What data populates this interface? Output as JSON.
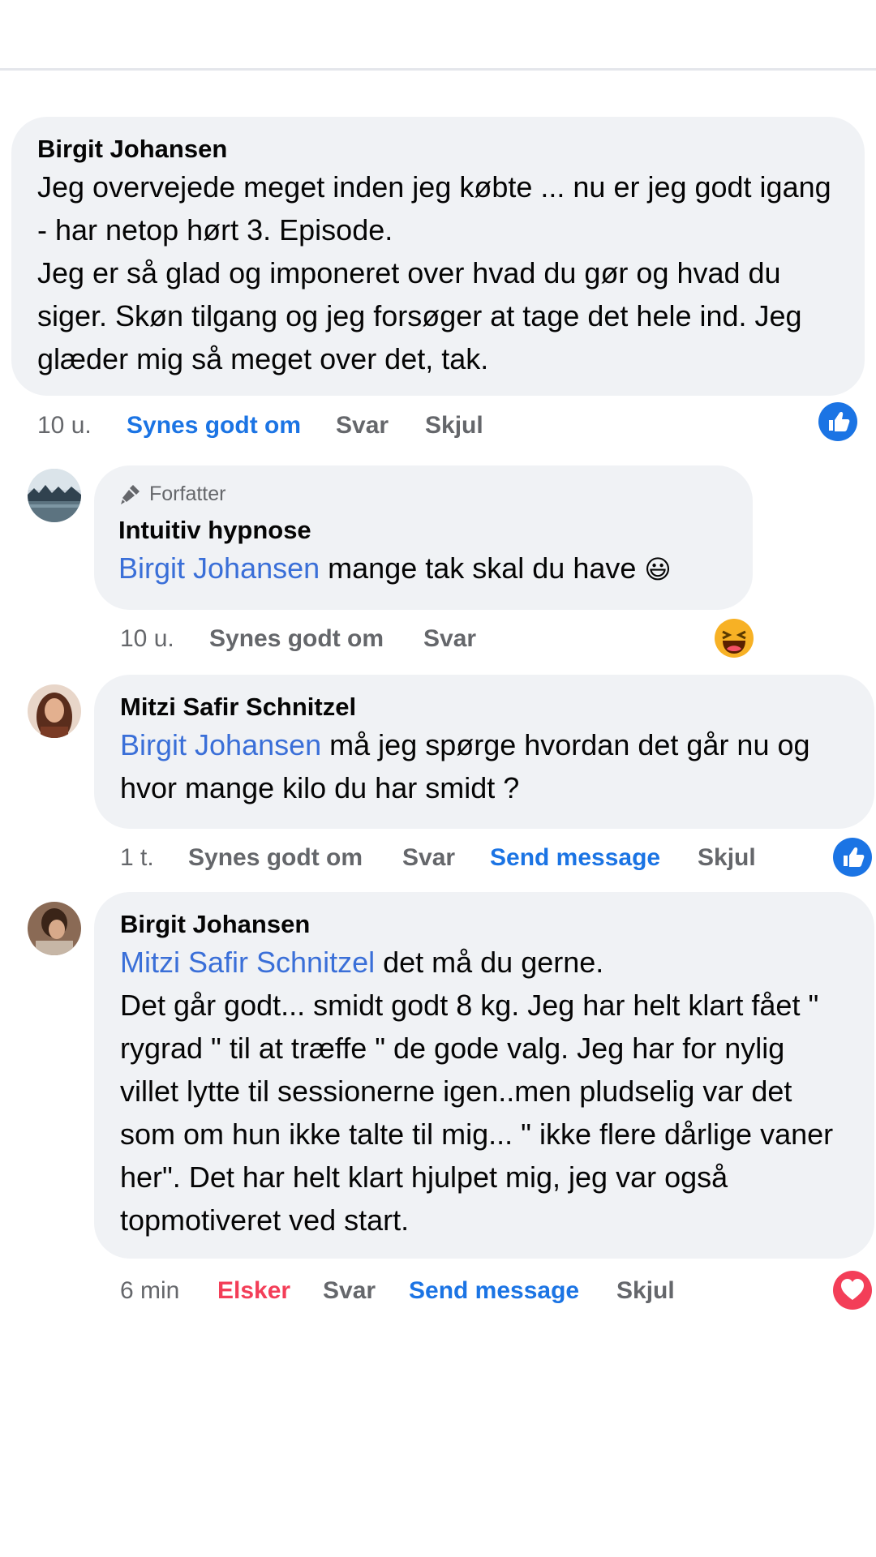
{
  "comments": [
    {
      "author": "Birgit Johansen",
      "text": "Jeg overvejede meget inden jeg købte ... nu er jeg godt igang - har netop hørt 3. Episode.\nJeg er så glad og imponeret over hvad du gør og hvad du siger. Skøn tilgang og jeg forsøger at tage det hele ind. Jeg glæder mig så meget over det, tak.",
      "time": "10 u.",
      "like": "Synes godt om",
      "reply": "Svar",
      "hide": "Skjul",
      "reaction": "like-icon"
    },
    {
      "badge": "Forfatter",
      "author": "Intuitiv hypnose",
      "mention": "Birgit Johansen",
      "text": " mange tak skal du have ",
      "emoji": "😃",
      "time": "10 u.",
      "like": "Synes godt om",
      "reply": "Svar",
      "reaction": "haha-icon"
    },
    {
      "author": "Mitzi Safir Schnitzel",
      "mention": "Birgit Johansen",
      "text": " må jeg spørge hvordan det går nu og hvor mange kilo du har smidt ?",
      "time": "1 t.",
      "like": "Synes godt om",
      "reply": "Svar",
      "message": "Send message",
      "hide": "Skjul",
      "reaction": "like-icon"
    },
    {
      "author": "Birgit Johansen",
      "mention": "Mitzi Safir Schnitzel",
      "text": " det må du gerne.\nDet går godt... smidt godt 8 kg. Jeg har helt klart fået \" rygrad \" til at træffe \" de gode valg. Jeg har for nylig villet lytte til sessionerne igen..men pludselig var det som om hun ikke talte til mig... \" ikke flere dårlige vaner her\". Det har helt klart hjulpet mig, jeg var også topmotiveret ved start.",
      "time": "6 min",
      "like": "Elsker",
      "reply": "Svar",
      "message": "Send message",
      "hide": "Skjul",
      "reaction": "love-icon"
    }
  ],
  "colors": {
    "bubble": "#f0f2f5",
    "mention": "#3a6fd8",
    "action_blue": "#1b74e4",
    "action_red": "#f33e58",
    "meta": "#65676b"
  }
}
